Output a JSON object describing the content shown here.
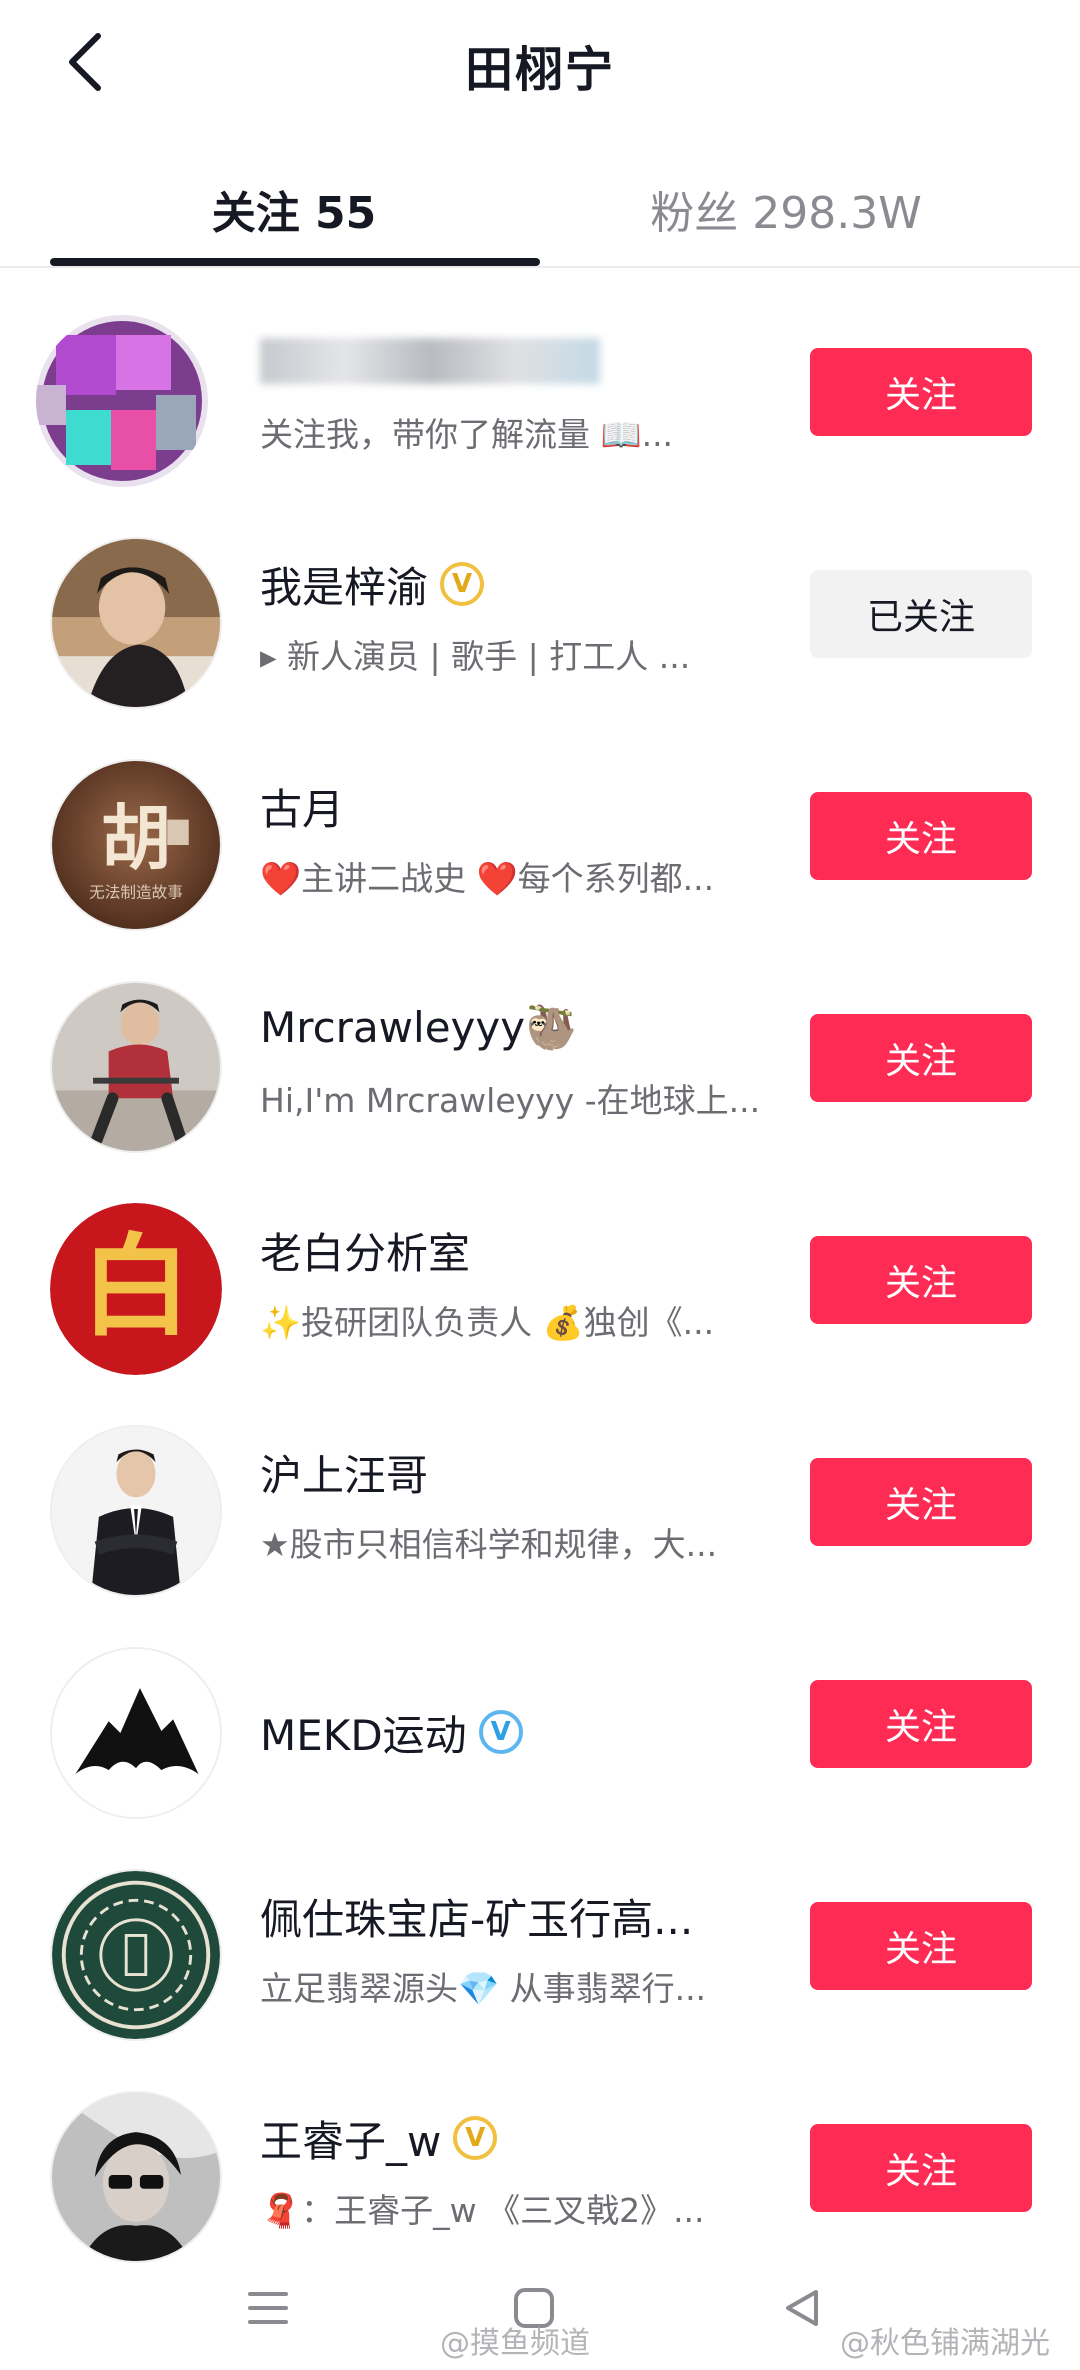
{
  "header": {
    "title": "田栩宁",
    "back_icon": "chevron-left-icon"
  },
  "tabs": [
    {
      "label": "关注 55",
      "active": true
    },
    {
      "label": "粉丝 298.3W",
      "active": false
    }
  ],
  "users": [
    {
      "name": "",
      "bio": "关注我，带你了解流量 📖...",
      "button": "关注",
      "followed": false,
      "badge": "",
      "avatar": "pixelated-avatar"
    },
    {
      "name": "我是梓渝",
      "bio": "▸ 新人演员 | 歌手 | 打工人 ...",
      "button": "已关注",
      "followed": true,
      "badge": "V",
      "avatar": "man-portrait-avatar"
    },
    {
      "name": "古月",
      "bio": "❤️主讲二战史 ❤️每个系列都...",
      "button": "关注",
      "followed": false,
      "badge": "",
      "avatar": "calligraphy-hu-avatar"
    },
    {
      "name": "Mrcrawleyyy🦥",
      "bio": "Hi,I'm Mrcrawleyyy -在地球上...",
      "button": "关注",
      "followed": false,
      "badge": "",
      "avatar": "seated-man-avatar"
    },
    {
      "name": "老白分析室",
      "bio": "✨投研团队负责人 💰独创《...",
      "button": "关注",
      "followed": false,
      "badge": "",
      "avatar": "bai-character-avatar"
    },
    {
      "name": "沪上汪哥",
      "bio": "★股市只相信科学和规律，大...",
      "button": "关注",
      "followed": false,
      "badge": "",
      "avatar": "suited-man-avatar"
    },
    {
      "name": "MEKD运动",
      "bio": "",
      "button": "关注",
      "followed": false,
      "badge": "V",
      "avatar": "mountain-logo-avatar"
    },
    {
      "name": "佩仕珠宝店-矿玉行高...",
      "bio": "立足翡翠源头💎 从事翡翠行...",
      "button": "关注",
      "followed": false,
      "badge": "",
      "avatar": "jade-pattern-avatar"
    },
    {
      "name": "王睿子_w",
      "bio": "🧣：王睿子_w 《三叉戟2》...",
      "button": "关注",
      "followed": false,
      "badge": "V",
      "avatar": "sunglasses-man-avatar"
    }
  ],
  "colors": {
    "accent": "#fe2c55",
    "followed_bg": "#f2f2f3",
    "text_primary": "#161823",
    "text_secondary": "#6c6d72",
    "tab_inactive": "#8a8b91",
    "verified_gold": "#f1c040",
    "verified_blue": "#5cb7f0"
  },
  "bottom_nav": {
    "icons": [
      "menu-icon",
      "home-square-icon",
      "back-triangle-icon"
    ]
  },
  "watermarks": [
    "@摸鱼频道",
    "@秋色铺满湖光"
  ]
}
